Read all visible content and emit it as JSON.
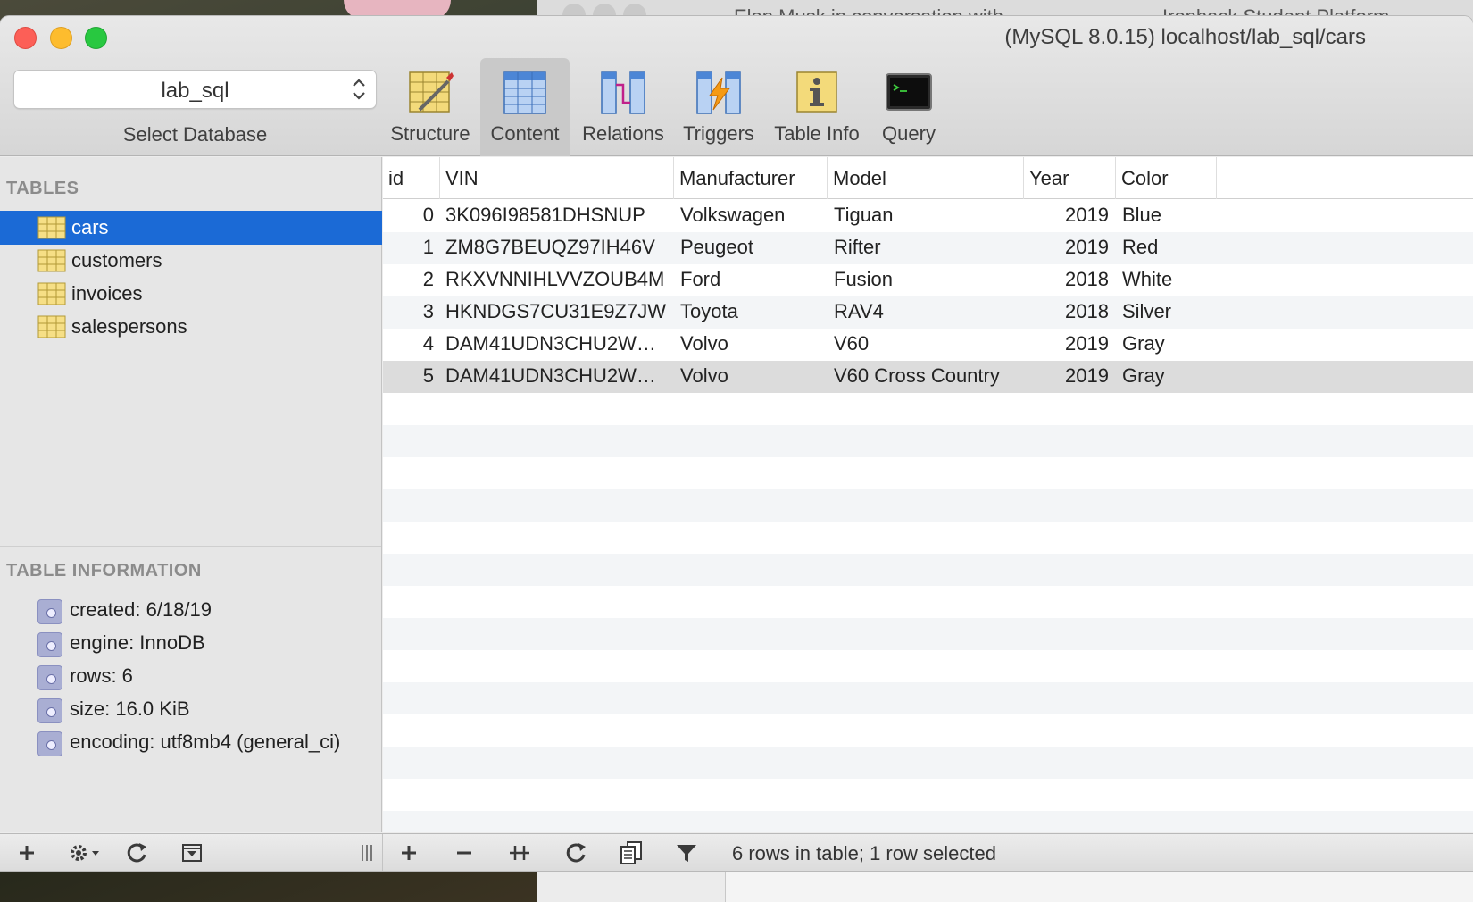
{
  "window": {
    "title": "(MySQL 8.0.15) localhost/lab_sql/cars"
  },
  "background": {
    "tab1": "Elon Musk in conversation with",
    "tab2": "Ironhack Student Platform"
  },
  "database_selector": {
    "value": "lab_sql",
    "label": "Select Database"
  },
  "toolbar": {
    "structure": "Structure",
    "content": "Content",
    "relations": "Relations",
    "triggers": "Triggers",
    "table_info": "Table Info",
    "query": "Query",
    "active": "Content"
  },
  "sidebar": {
    "tables_header": "TABLES",
    "tables": [
      {
        "name": "cars",
        "selected": true
      },
      {
        "name": "customers",
        "selected": false
      },
      {
        "name": "invoices",
        "selected": false
      },
      {
        "name": "salespersons",
        "selected": false
      }
    ],
    "info_header": "TABLE INFORMATION",
    "info": [
      "created: 6/18/19",
      "engine: InnoDB",
      "rows: 6",
      "size: 16.0 KiB",
      "encoding: utf8mb4 (general_ci)"
    ]
  },
  "grid": {
    "columns": [
      "id",
      "VIN",
      "Manufacturer",
      "Model",
      "Year",
      "Color"
    ],
    "rows": [
      {
        "id": "0",
        "vin": "3K096I98581DHSNUP",
        "manufacturer": "Volkswagen",
        "model": "Tiguan",
        "year": "2019",
        "color": "Blue"
      },
      {
        "id": "1",
        "vin": "ZM8G7BEUQZ97IH46V",
        "manufacturer": "Peugeot",
        "model": "Rifter",
        "year": "2019",
        "color": "Red"
      },
      {
        "id": "2",
        "vin": "RKXVNNIHLVVZOUB4M",
        "manufacturer": "Ford",
        "model": "Fusion",
        "year": "2018",
        "color": "White"
      },
      {
        "id": "3",
        "vin": "HKNDGS7CU31E9Z7JW",
        "manufacturer": "Toyota",
        "model": "RAV4",
        "year": "2018",
        "color": "Silver"
      },
      {
        "id": "4",
        "vin": "DAM41UDN3CHU2W…",
        "manufacturer": "Volvo",
        "model": "V60",
        "year": "2019",
        "color": "Gray"
      },
      {
        "id": "5",
        "vin": "DAM41UDN3CHU2W…",
        "manufacturer": "Volvo",
        "model": "V60 Cross Country",
        "year": "2019",
        "color": "Gray"
      }
    ],
    "selected_row": 5
  },
  "bottombar": {
    "status": "6 rows in table; 1 row selected",
    "icons": [
      "plus-icon",
      "gear-icon",
      "refresh-icon",
      "filter-box-icon",
      "column-resize-icon",
      "plus-icon",
      "minus-icon",
      "duplicate-row-icon",
      "refresh-icon",
      "copy-icon",
      "filter-icon"
    ]
  },
  "colors": {
    "selection": "#1b6ad6",
    "traffic_close": "#fc5f57",
    "traffic_minimize": "#fdbc2e",
    "traffic_zoom": "#28c840"
  }
}
